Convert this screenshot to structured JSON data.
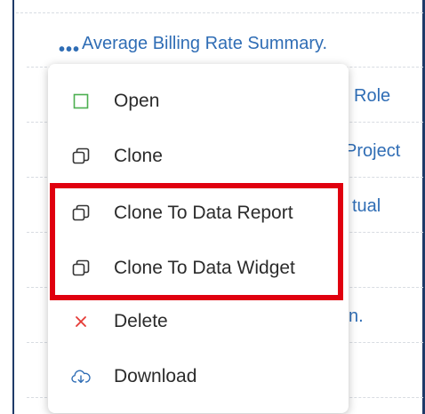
{
  "background_list": {
    "rows": [
      {
        "title": "Average Billing Rate Summary."
      },
      {
        "title": "Role"
      },
      {
        "title": "Project"
      },
      {
        "title": "tual"
      },
      {
        "title": ""
      },
      {
        "title": "n."
      }
    ]
  },
  "context_menu": {
    "items": [
      {
        "label": "Open",
        "icon": "open-square-icon"
      },
      {
        "label": "Clone",
        "icon": "clone-icon"
      },
      {
        "label": "Clone To Data Report",
        "icon": "clone-icon"
      },
      {
        "label": "Clone To Data Widget",
        "icon": "clone-icon"
      },
      {
        "label": "Delete",
        "icon": "delete-x-icon"
      },
      {
        "label": "Download",
        "icon": "cloud-download-icon"
      }
    ]
  },
  "colors": {
    "link": "#2f6db5",
    "highlight": "#e0000f",
    "open_icon": "#4caf50",
    "delete_icon": "#e53935",
    "download_icon": "#2f6db5"
  }
}
